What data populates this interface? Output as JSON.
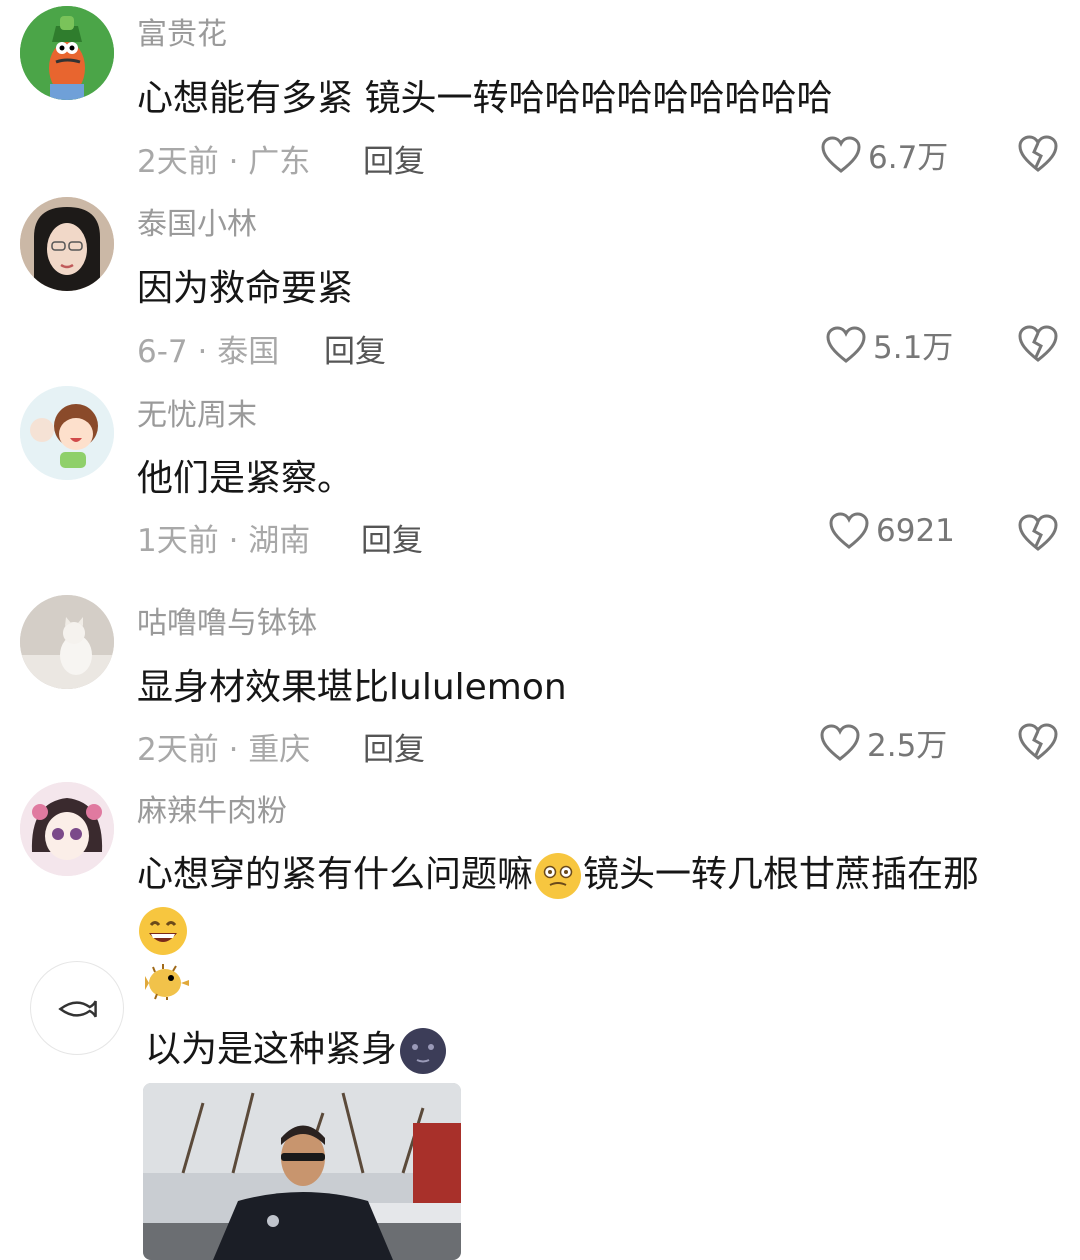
{
  "comments": [
    {
      "username": "富贵花",
      "text": "心想能有多紧 镜头一转哈哈哈哈哈哈哈哈哈",
      "date": "2天前",
      "location": "广东",
      "reply": "回复",
      "likes": "6.7万",
      "avatar": "cartoon-fish-hat-avatar"
    },
    {
      "username": "泰国小林",
      "text": "因为救命要紧",
      "date": "6-7",
      "location": "泰国",
      "reply": "回复",
      "likes": "5.1万",
      "avatar": "woman-glasses-avatar"
    },
    {
      "username": "无忧周末",
      "text": "他们是紧察。",
      "date": "1天前",
      "location": "湖南",
      "reply": "回复",
      "likes": "6921",
      "avatar": "cartoon-girl-avatar"
    },
    {
      "username": "咕噜噜与钵钵",
      "text": "显身材效果堪比lululemon",
      "date": "2天前",
      "location": "重庆",
      "reply": "回复",
      "likes": "2.5万",
      "avatar": "white-cat-avatar"
    },
    {
      "username": "麻辣牛肉粉",
      "text_part1": "心想穿的紧有什么问题嘛",
      "text_part2": "镜头一转几根甘蔗插在那",
      "avatar": "anime-girl-avatar"
    },
    {
      "username_emoji": "pufferfish-emoji",
      "text": "以为是这种紧身",
      "avatar": "fish-outline-avatar"
    }
  ],
  "meta_separator": " · ",
  "colors": {
    "text": "#161616",
    "username": "#9a9a9a",
    "meta": "#a8a8a8",
    "reply": "#555555",
    "icon": "#777777"
  }
}
